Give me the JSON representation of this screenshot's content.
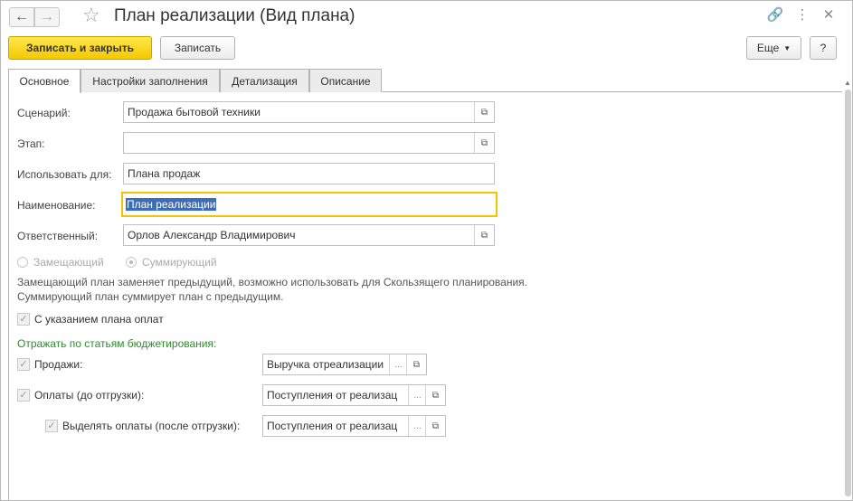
{
  "window": {
    "title": "План реализации (Вид плана)",
    "icons": {
      "back": "arrow-left-icon",
      "forward": "arrow-right-icon",
      "favorite": "star-icon",
      "link": "link-icon",
      "more": "more-vertical-icon",
      "close": "close-icon"
    }
  },
  "toolbar": {
    "save_close_label": "Записать и закрыть",
    "save_label": "Записать",
    "more_label": "Еще",
    "help_label": "?"
  },
  "tabs": [
    {
      "label": "Основное",
      "active": true
    },
    {
      "label": "Настройки заполнения",
      "active": false
    },
    {
      "label": "Детализация",
      "active": false
    },
    {
      "label": "Описание",
      "active": false
    }
  ],
  "form": {
    "scenario": {
      "label": "Сценарий:",
      "value": "Продажа бытовой техники"
    },
    "stage": {
      "label": "Этап:",
      "value": ""
    },
    "use_for": {
      "label": "Использовать для:",
      "value": "Плана продаж"
    },
    "name": {
      "label": "Наименование:",
      "value": "План реализации"
    },
    "responsible": {
      "label": "Ответственный:",
      "value": "Орлов Александр Владимирович"
    },
    "plan_type": {
      "options": [
        "Замещающий",
        "Суммирующий"
      ],
      "selected": "Суммирующий",
      "disabled": true
    },
    "note_line1": "Замещающий план заменяет предыдущий, возможно использовать для Скользящего планирования.",
    "note_line2": "Суммирующий план суммирует план с предыдущим.",
    "payment_plan_check": {
      "label": "С указанием плана оплат",
      "checked": true
    },
    "budget_title": "Отражать по статьям бюджетирования:",
    "sales": {
      "label": "Продажи:",
      "checked": true,
      "value": "Выручка отреализации"
    },
    "payments_before": {
      "label": "Оплаты (до отгрузки):",
      "checked": true,
      "value": "Поступления от реализац"
    },
    "payments_after": {
      "label": "Выделять оплаты (после отгрузки):",
      "checked": true,
      "value": "Поступления от реализац"
    },
    "dots": "...",
    "check_mark": "✓",
    "open_icon": "open-form-icon"
  },
  "colors": {
    "primary_button": "#f5c800",
    "group_title": "#2f8a2f",
    "selection": "#3d6eb5",
    "focus_border": "#f4c400"
  }
}
